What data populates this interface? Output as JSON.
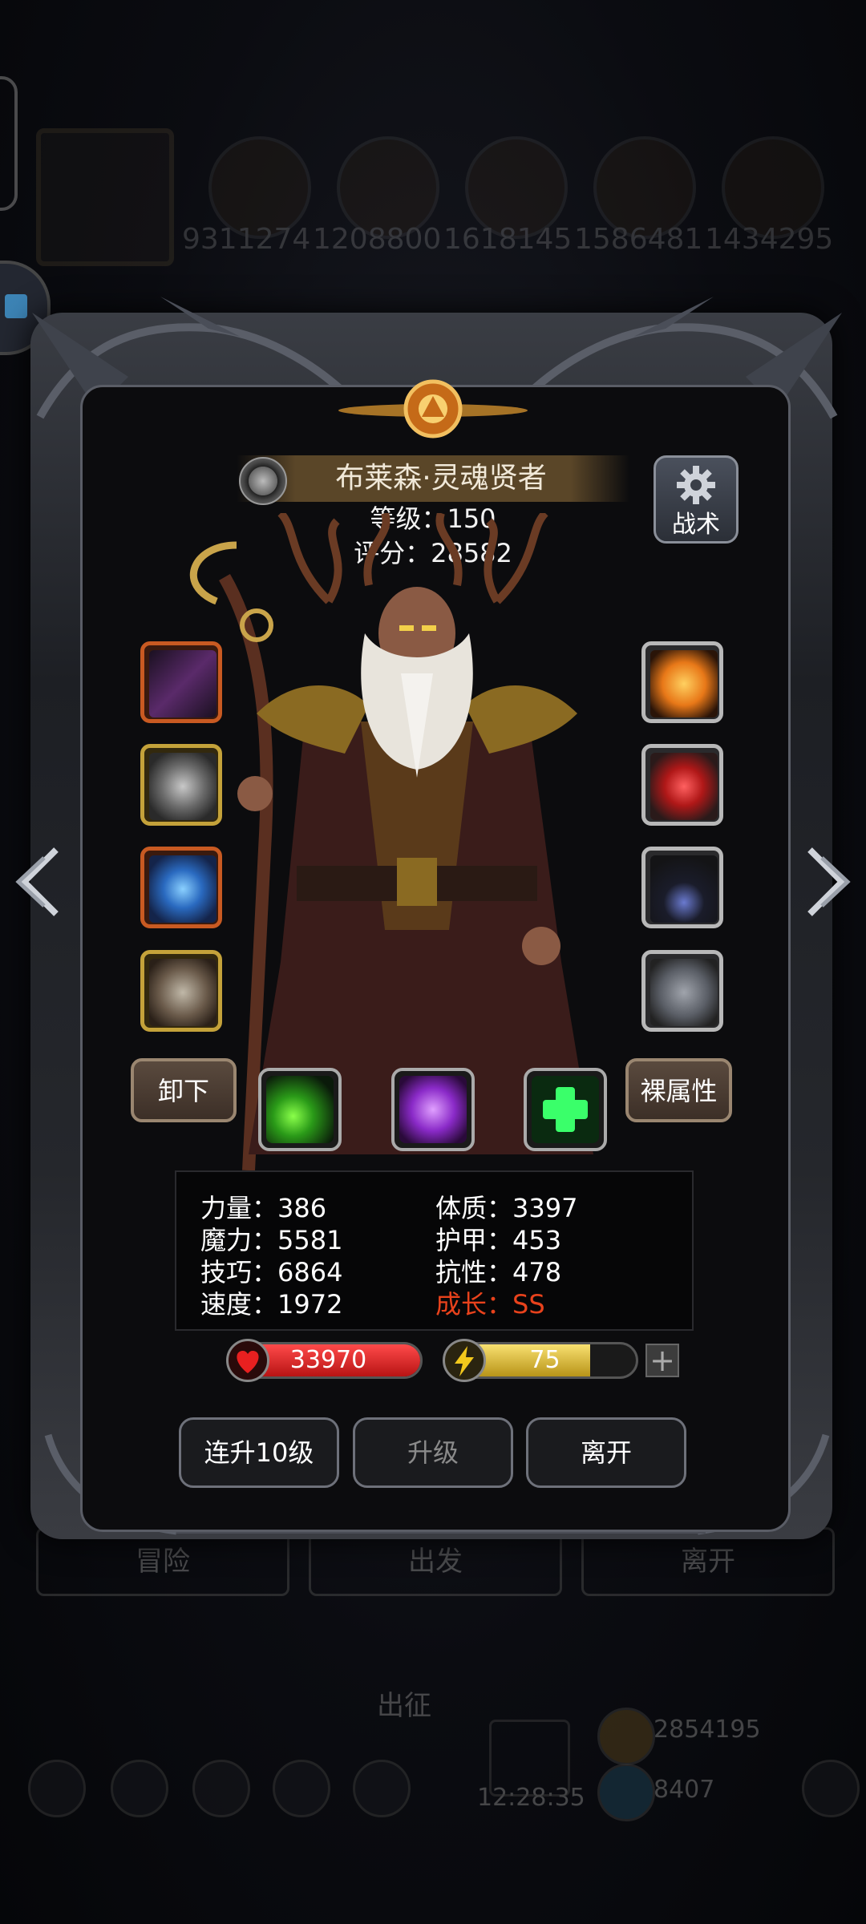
{
  "background": {
    "resources": [
      "9311274",
      "1208800",
      "1618145",
      "1586481",
      "1434295"
    ],
    "bottom_buttons": [
      "冒险",
      "出发",
      "离开"
    ],
    "expedition_label": "出征",
    "clock": "12:28:35",
    "gold_amount": "2854195",
    "gem_amount_partial": "8407"
  },
  "hero": {
    "name": "布莱森·灵魂贤者",
    "level_text": "等级：150",
    "score_text": "评分：28582",
    "tactics_label": "战术"
  },
  "actions": {
    "unequip_label": "卸下",
    "base_attr_label": "裸属性"
  },
  "stats": {
    "strength": "力量：386",
    "constitution": "体质：3397",
    "magic": "魔力：5581",
    "armor": "护甲：453",
    "skill": "技巧：6864",
    "resistance": "抗性：478",
    "speed": "速度：1972",
    "growth": "成长：SS"
  },
  "bars": {
    "hp_value": "33970",
    "energy_value": "75",
    "energy_fill": 0.75,
    "plus_label": "+"
  },
  "buttons": {
    "level10": "连升10级",
    "level_up": "升级",
    "leave": "离开"
  },
  "colors": {
    "growth_red": "#e8421c",
    "hp_red": "#d42020",
    "energy_yellow": "#e8c640",
    "slot_orange": "#c85a22",
    "slot_gold": "#c4a23a"
  },
  "icons": {
    "left_arrow": "chevron-left-icon",
    "right_arrow": "chevron-right-icon",
    "tactics": "gear-icon",
    "hp": "heart-icon",
    "energy": "lightning-icon"
  }
}
